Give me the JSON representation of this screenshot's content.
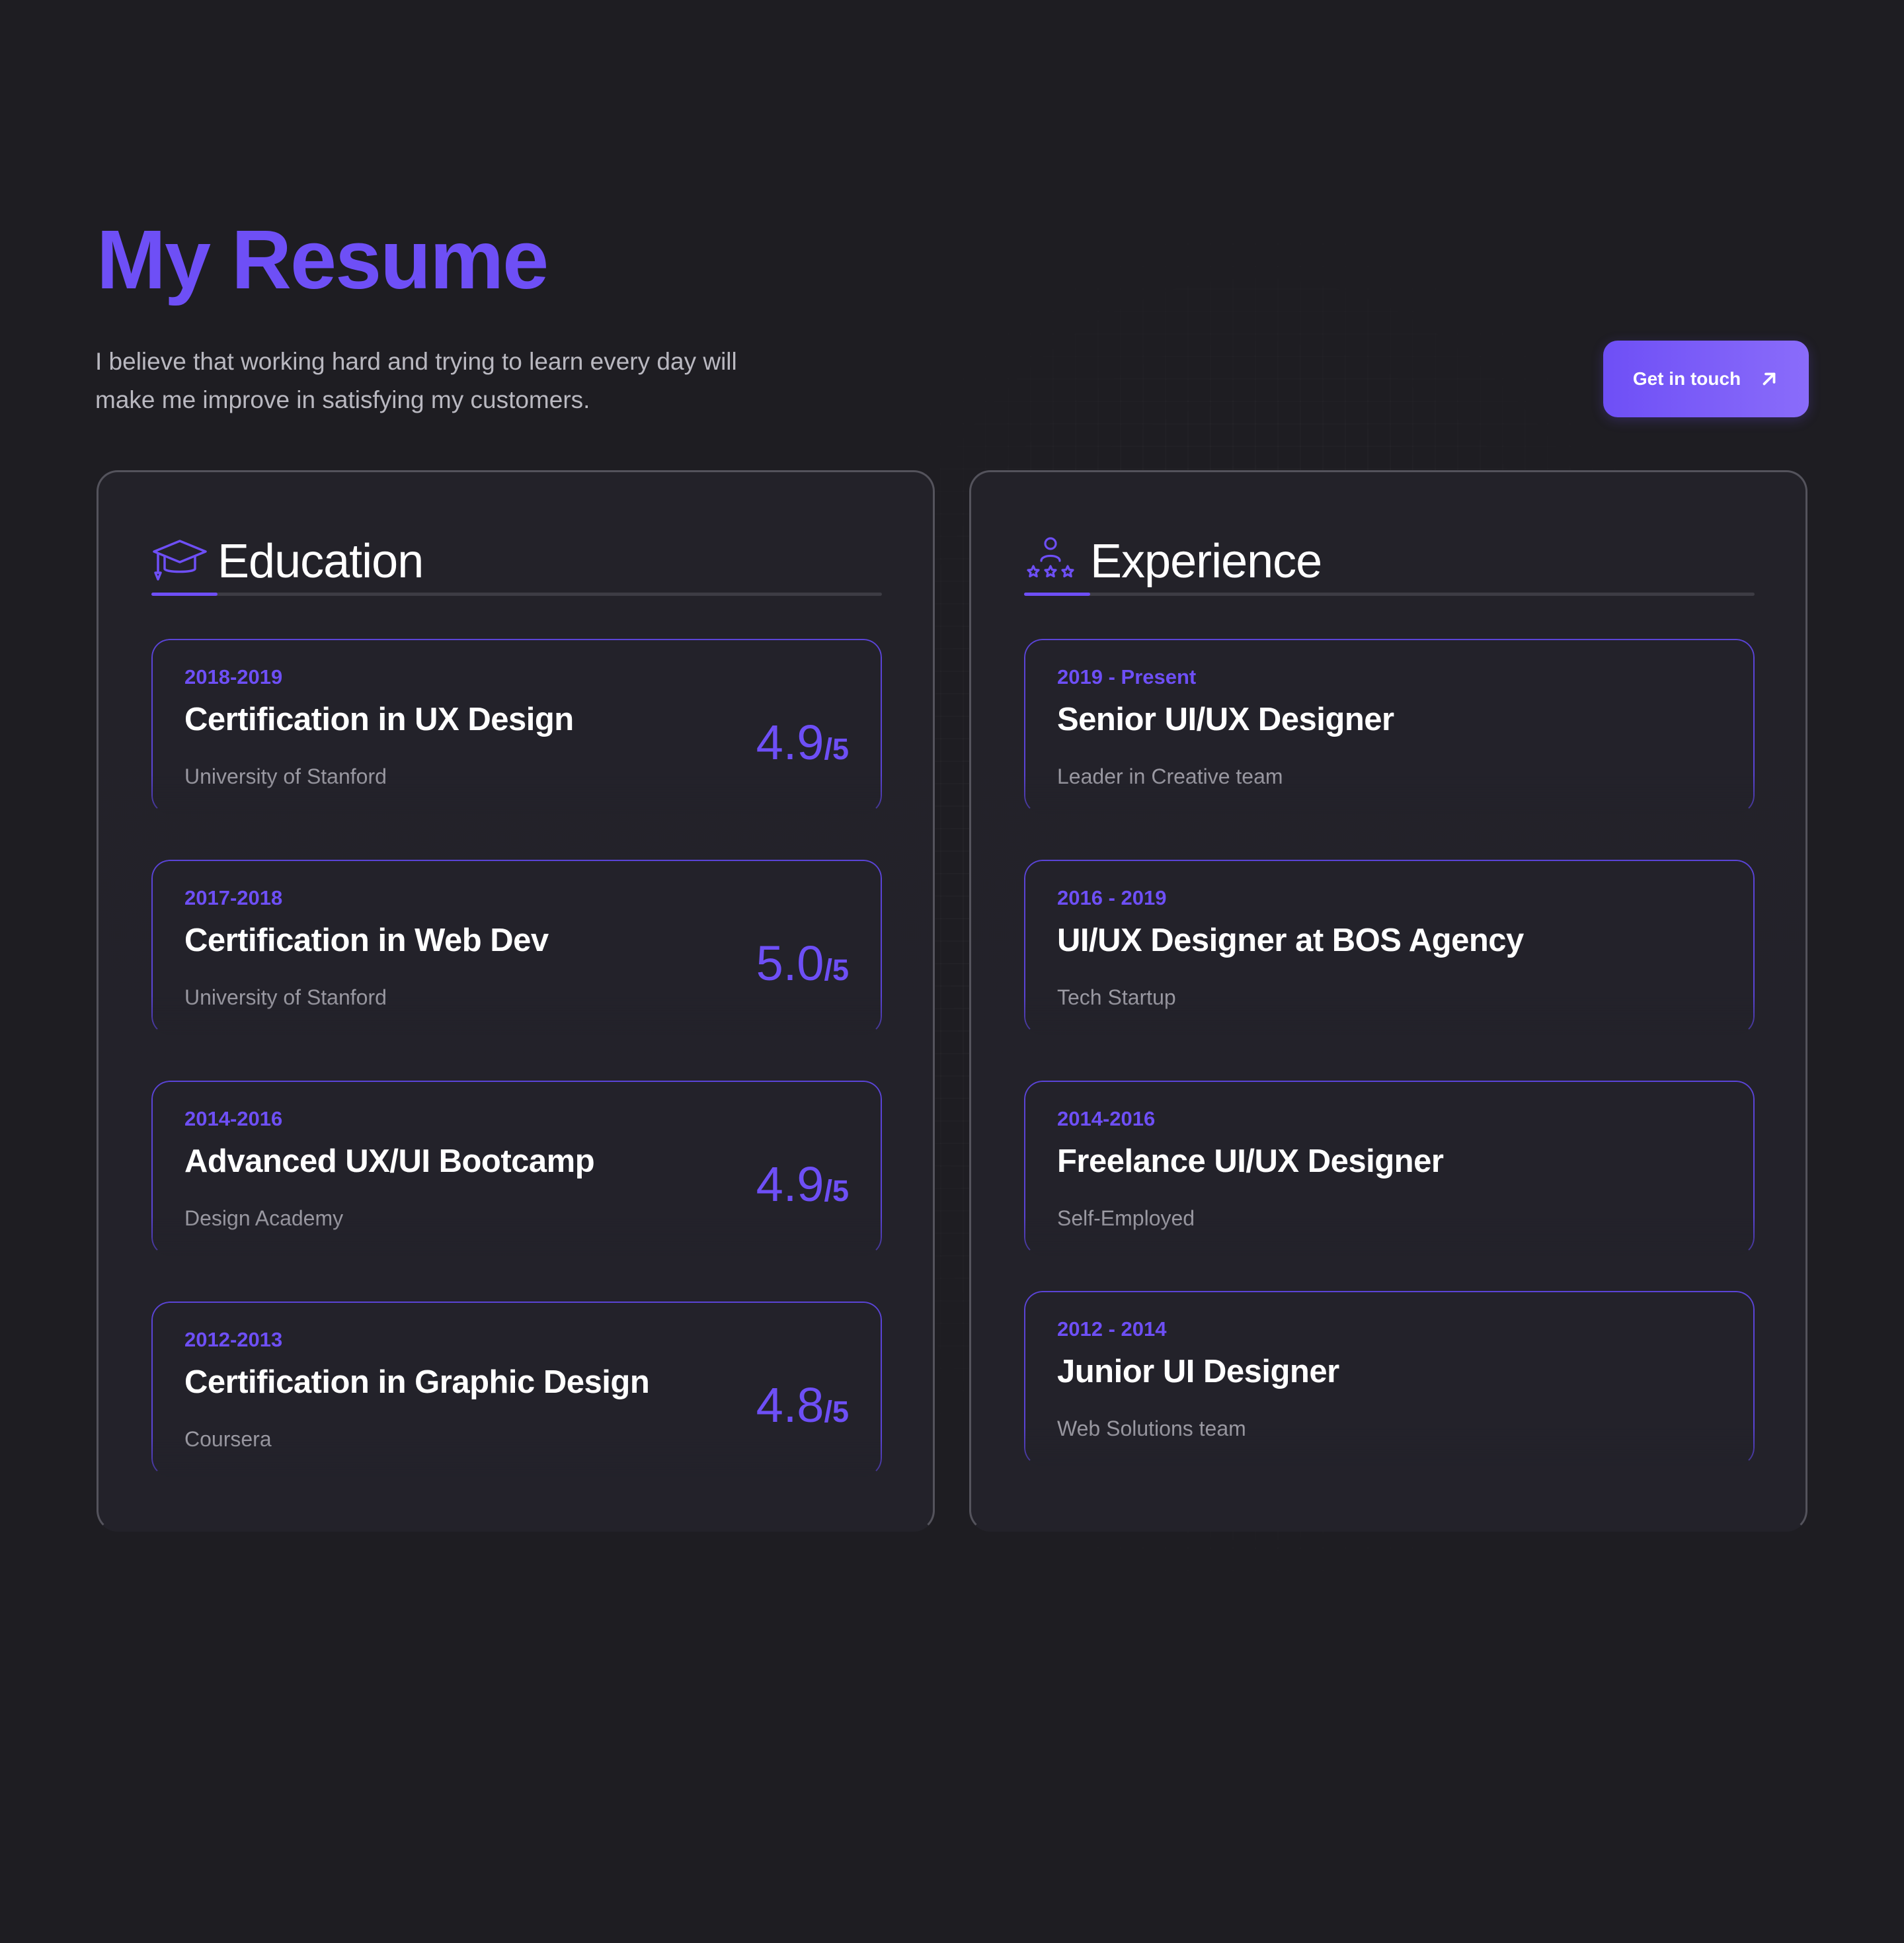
{
  "header": {
    "title": "My Resume",
    "subtitle_line1": "I believe that working hard and trying to learn every day will",
    "subtitle_line2": "make me improve in satisfying my customers.",
    "cta_label": "Get in touch",
    "cta_icon": "arrow-up-right-icon"
  },
  "colors": {
    "background": "#1e1d22",
    "accent": "#6e4ff6",
    "panel": "#23222a",
    "text": "#ffffff",
    "muted": "#9b9aa3"
  },
  "education": {
    "heading": "Education",
    "icon": "graduation-cap-icon",
    "items": [
      {
        "period": "2018-2019",
        "title": "Certification in UX Design",
        "org": "University of Stanford",
        "score": "4.9",
        "score_suffix": "/5"
      },
      {
        "period": "2017-2018",
        "title": "Certification in Web Dev",
        "org": "University of Stanford",
        "score": "5.0",
        "score_suffix": "/5"
      },
      {
        "period": "2014-2016",
        "title": "Advanced UX/UI Bootcamp",
        "org": "Design Academy",
        "score": "4.9",
        "score_suffix": "/5"
      },
      {
        "period": "2012-2013",
        "title": "Certification in Graphic Design",
        "org": "Coursera",
        "score": "4.8",
        "score_suffix": "/5"
      }
    ]
  },
  "experience": {
    "heading": "Experience",
    "icon": "person-stars-icon",
    "items": [
      {
        "period": "2019 - Present",
        "title": "Senior UI/UX Designer",
        "org": "Leader in Creative team"
      },
      {
        "period": "2016 - 2019",
        "title": "UI/UX Designer at BOS Agency",
        "org": "Tech Startup"
      },
      {
        "period": "2014-2016",
        "title": "Freelance UI/UX Designer",
        "org": "Self-Employed"
      },
      {
        "period": "2012 - 2014",
        "title": "Junior UI Designer",
        "org": "Web Solutions team"
      }
    ]
  }
}
